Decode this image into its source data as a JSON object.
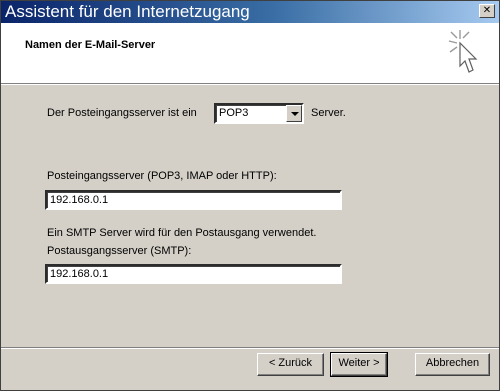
{
  "window": {
    "title": "Assistent für den Internetzugang",
    "close_glyph": "✕"
  },
  "header": {
    "subtitle": "Namen der E-Mail-Server"
  },
  "incoming_type": {
    "prefix": "Der Posteingangsserver ist ein",
    "value": "POP3",
    "suffix": "Server."
  },
  "incoming_server": {
    "label": "Posteingangsserver (POP3, IMAP oder HTTP):",
    "value": "192.168.0.1"
  },
  "smtp_info": "Ein SMTP Server wird für den Postausgang verwendet.",
  "outgoing_server": {
    "label": "Postausgangsserver (SMTP):",
    "value": "192.168.0.1"
  },
  "buttons": {
    "back": "< Zurück",
    "next": "Weiter >",
    "cancel": "Abbrechen"
  },
  "icons": {
    "wizard": "wizard-sparkle-cursor-icon",
    "dropdown": "chevron-down-icon"
  }
}
